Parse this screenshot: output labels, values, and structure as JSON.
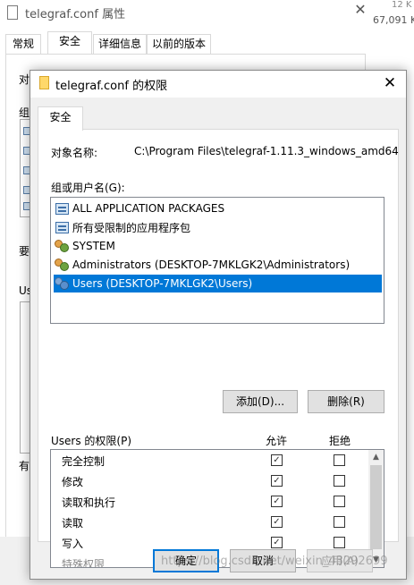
{
  "background_window": {
    "title": "telegraf.conf 属性",
    "close_glyph": "✕",
    "side_text_1": "12 K",
    "side_text_2": "67,091 K",
    "tabs": [
      {
        "label": "常规"
      },
      {
        "label": "安全",
        "active": true
      },
      {
        "label": "详细信息"
      },
      {
        "label": "以前的版本"
      }
    ],
    "label_obj": "对",
    "label_group": "组",
    "label_req": "要",
    "label_users": "Us",
    "label_has": "有"
  },
  "dialog": {
    "title": "telegraf.conf 的权限",
    "close_glyph": "✕",
    "tab_label": "安全",
    "object_name_label": "对象名称:",
    "object_name_value": "C:\\Program Files\\telegraf-1.11.3_windows_amd64",
    "groups_label": "组或用户名(G):",
    "users": [
      {
        "name": "ALL APPLICATION PACKAGES",
        "icon": "package-icon"
      },
      {
        "name": "所有受限制的应用程序包",
        "icon": "package-icon"
      },
      {
        "name": "SYSTEM",
        "icon": "users-icon"
      },
      {
        "name": "Administrators (DESKTOP-7MKLGK2\\Administrators)",
        "icon": "users-icon"
      },
      {
        "name": "Users (DESKTOP-7MKLGK2\\Users)",
        "icon": "users-icon",
        "selected": true
      }
    ],
    "add_button": "添加(D)...",
    "remove_button": "删除(R)",
    "permissions_label": "Users 的权限(P)",
    "allow_header": "允许",
    "deny_header": "拒绝",
    "permissions": [
      {
        "name": "完全控制",
        "allow": true,
        "deny": false
      },
      {
        "name": "修改",
        "allow": true,
        "deny": false
      },
      {
        "name": "读取和执行",
        "allow": true,
        "deny": false
      },
      {
        "name": "读取",
        "allow": true,
        "deny": false
      },
      {
        "name": "写入",
        "allow": true,
        "deny": false
      },
      {
        "name": "特殊权限",
        "allow": false,
        "deny": false,
        "partially_hidden": true
      }
    ],
    "checkmark_glyph": "✓",
    "scroll_up_glyph": "▲",
    "scroll_down_glyph": "▼",
    "ok_button": "确定",
    "cancel_button": "取消",
    "apply_button": "应用(A)"
  },
  "watermark": "https://blog.csdn.net/weixin_43292699"
}
